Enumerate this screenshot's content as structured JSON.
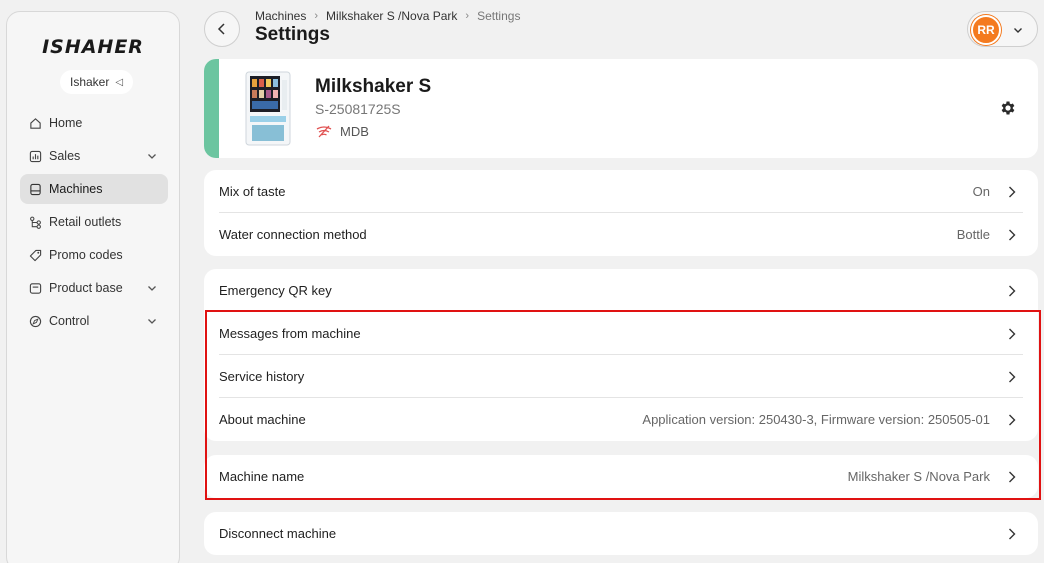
{
  "sidebar": {
    "logo": "ISHAHER",
    "user": "Ishaker",
    "items": [
      {
        "label": "Home",
        "icon": "home-icon"
      },
      {
        "label": "Sales",
        "icon": "chart-icon",
        "expandable": true
      },
      {
        "label": "Machines",
        "icon": "machine-icon",
        "active": true
      },
      {
        "label": "Retail outlets",
        "icon": "outlets-icon"
      },
      {
        "label": "Promo codes",
        "icon": "tag-icon"
      },
      {
        "label": "Product base",
        "icon": "box-icon",
        "expandable": true
      },
      {
        "label": "Control",
        "icon": "compass-icon",
        "expandable": true
      }
    ]
  },
  "header": {
    "breadcrumb": [
      "Machines",
      "Milkshaker S /Nova Park",
      "Settings"
    ],
    "title": "Settings",
    "avatar_initials": "RR"
  },
  "machine": {
    "name": "Milkshaker S",
    "serial": "S-25081725S",
    "payment": "MDB",
    "status_color": "#6cc5a0"
  },
  "groups": [
    [
      {
        "label": "Mix of taste",
        "value": "On"
      },
      {
        "label": "Water connection method",
        "value": "Bottle"
      }
    ],
    [
      {
        "label": "Emergency QR key",
        "value": ""
      },
      {
        "label": "Messages from machine",
        "value": ""
      },
      {
        "label": "Service history",
        "value": ""
      },
      {
        "label": "About machine",
        "value": "Application version: 250430-3, Firmware version: 250505-01"
      }
    ],
    [
      {
        "label": "Machine name",
        "value": "Milkshaker S /Nova Park"
      }
    ],
    [
      {
        "label": "Disconnect machine",
        "value": ""
      }
    ]
  ],
  "colors": {
    "accent_avatar": "#f47a1f",
    "highlight": "#e01212"
  }
}
